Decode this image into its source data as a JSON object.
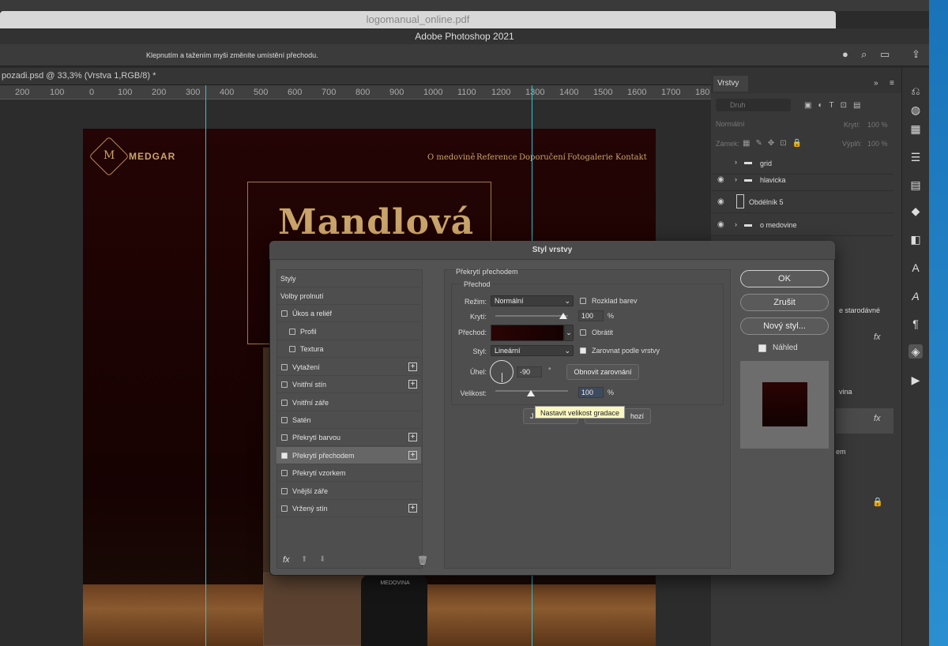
{
  "os": {
    "window_title_bg": "logomanual_online.pdf"
  },
  "app": {
    "title": "Adobe Photoshop 2021",
    "hint": "Klepnutím a tažením myši změníte umístění přechodu."
  },
  "document": {
    "tab": "pozadi.psd @ 33,3% (Vrstva 1,RGB/8) *"
  },
  "ruler": {
    "ticks": [
      "200",
      "100",
      "0",
      "100",
      "200",
      "300",
      "400",
      "500",
      "600",
      "700",
      "800",
      "900",
      "1000",
      "1100",
      "1200",
      "1300",
      "1400",
      "1500",
      "1600",
      "1700",
      "180"
    ]
  },
  "artwork": {
    "brand": "MEDGAR",
    "logo_letter": "M",
    "nav": [
      "O medovině",
      "Reference",
      "Doporučení",
      "Fotogalerie",
      "Kontakt"
    ],
    "headline": "Mandlová",
    "bottle_label": "MEDOVINA"
  },
  "layers_panel": {
    "tab": "Vrstvy",
    "search_placeholder": "Druh",
    "blend": "Normální",
    "opacity_label": "Krytí:",
    "opacity_value": "100 %",
    "lock_label": "Zámek:",
    "fill_label": "Výplň:",
    "fill_value": "100 %",
    "layers": [
      {
        "name": "grid",
        "visible": false
      },
      {
        "name": "hlavicka",
        "visible": true
      },
      {
        "name": "Obdélník 5",
        "visible": true
      },
      {
        "name": "o medovine",
        "visible": true
      }
    ],
    "partial_texts": [
      "e starodávné",
      "vina",
      "em"
    ],
    "fx": "fx"
  },
  "dialog": {
    "title": "Styl vrstvy",
    "styles": [
      {
        "label": "Styly",
        "header": true
      },
      {
        "label": "Volby prolnutí",
        "header": true
      },
      {
        "label": "Úkos a reliéf",
        "checked": false,
        "plus": false
      },
      {
        "label": "Profil",
        "checked": false,
        "plus": false,
        "indent": true
      },
      {
        "label": "Textura",
        "checked": false,
        "plus": false,
        "indent": true
      },
      {
        "label": "Vytažení",
        "checked": false,
        "plus": true
      },
      {
        "label": "Vnitřní stín",
        "checked": false,
        "plus": true
      },
      {
        "label": "Vnitřní záře",
        "checked": false,
        "plus": false
      },
      {
        "label": "Satén",
        "checked": false,
        "plus": false
      },
      {
        "label": "Překrytí barvou",
        "checked": false,
        "plus": true
      },
      {
        "label": "Překrytí přechodem",
        "checked": true,
        "plus": true,
        "selected": true
      },
      {
        "label": "Překrytí vzorkem",
        "checked": false,
        "plus": false
      },
      {
        "label": "Vnější záře",
        "checked": false,
        "plus": false
      },
      {
        "label": "Vržený stín",
        "checked": false,
        "plus": true
      }
    ],
    "section_title": "Překrytí přechodem",
    "group_title": "Přechod",
    "mode_label": "Režim:",
    "mode_value": "Normální",
    "dither_label": "Rozklad barev",
    "opacity_label": "Krytí:",
    "opacity_value": "100",
    "opacity_level": 1.0,
    "percent": "%",
    "gradient_label": "Přechod:",
    "reverse_label": "Obrátit",
    "style_label": "Styl:",
    "style_value": "Lineární",
    "align_label": "Zarovnat podle vrstvy",
    "align_checked": true,
    "angle_label": "Úhel:",
    "angle_value": "-90",
    "degree": "°",
    "reset_align": "Obnovit zarovnání",
    "scale_label": "Velikost:",
    "scale_value": "100",
    "scale_level": 0.75,
    "btn_default_partial": "J",
    "btn_reset_partial": "hozí",
    "tooltip": "Nastavit velikost gradace",
    "ok": "OK",
    "cancel": "Zrušit",
    "new_style": "Nový styl...",
    "preview_label": "Náhled",
    "preview_checked": true,
    "fx_footer": "fx"
  }
}
